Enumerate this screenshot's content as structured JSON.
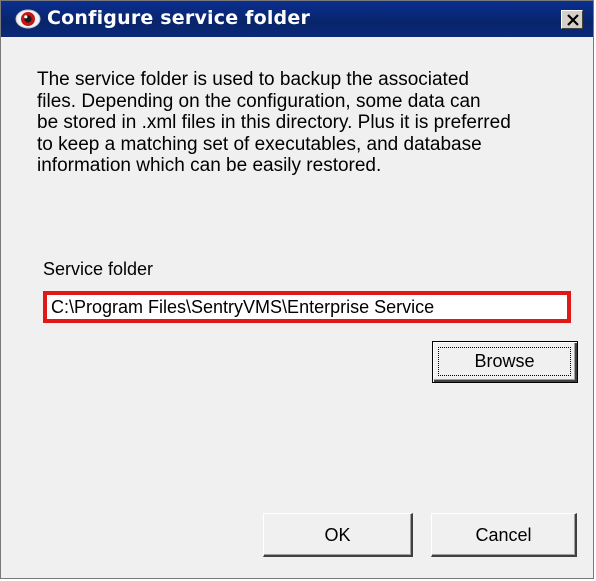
{
  "window": {
    "title": "Configure service folder",
    "icon": "eye-icon",
    "close_icon": "close-icon"
  },
  "description": "The service folder is used to backup the associated\nfiles.  Depending on the configuration, some data can\nbe stored in .xml files in this directory.  Plus it is preferred\nto keep a matching set of executables, and database\ninformation which can be easily restored.",
  "service_folder": {
    "label": "Service folder",
    "value": "C:\\Program Files\\SentryVMS\\Enterprise Service",
    "highlight_color": "#e01818"
  },
  "buttons": {
    "browse": "Browse",
    "ok": "OK",
    "cancel": "Cancel"
  },
  "colors": {
    "titlebar": "#0b2f90",
    "dialog_background": "#f0f0f0"
  }
}
